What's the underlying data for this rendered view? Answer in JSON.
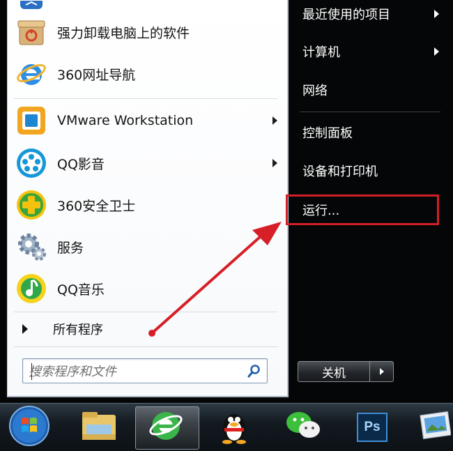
{
  "start_menu": {
    "programs": [
      {
        "label": "强力卸载电脑上的软件",
        "icon": "uninstaller-box-icon"
      },
      {
        "label": "360网址导航",
        "icon": "ie-browser-icon"
      },
      {
        "label": "VMware Workstation",
        "icon": "vmware-icon",
        "has_submenu": true
      },
      {
        "label": "QQ影音",
        "icon": "qq-player-icon",
        "has_submenu": true
      },
      {
        "label": "360安全卫士",
        "icon": "360-guard-icon"
      },
      {
        "label": "服务",
        "icon": "services-gear-icon"
      },
      {
        "label": "QQ音乐",
        "icon": "qq-music-icon"
      }
    ],
    "all_programs_label": "所有程序",
    "search": {
      "placeholder": "搜索程序和文件"
    },
    "right_items": [
      {
        "label": "最近使用的项目",
        "has_submenu": true
      },
      {
        "label": "计算机",
        "has_submenu": true
      },
      {
        "label": "网络"
      },
      {
        "label": "控制面板"
      },
      {
        "label": "设备和打印机"
      },
      {
        "label": "运行..."
      }
    ],
    "highlighted_item": "运行...",
    "highlight_color": "#d21f27",
    "shutdown_label": "关机"
  },
  "taskbar": {
    "items": [
      "start-orb-icon",
      "windows-explorer-icon",
      "360-browser-icon",
      "qq-penguin-icon",
      "wechat-icon",
      "photoshop-icon",
      "photo-viewer-icon"
    ],
    "photoshop_label": "Ps"
  }
}
